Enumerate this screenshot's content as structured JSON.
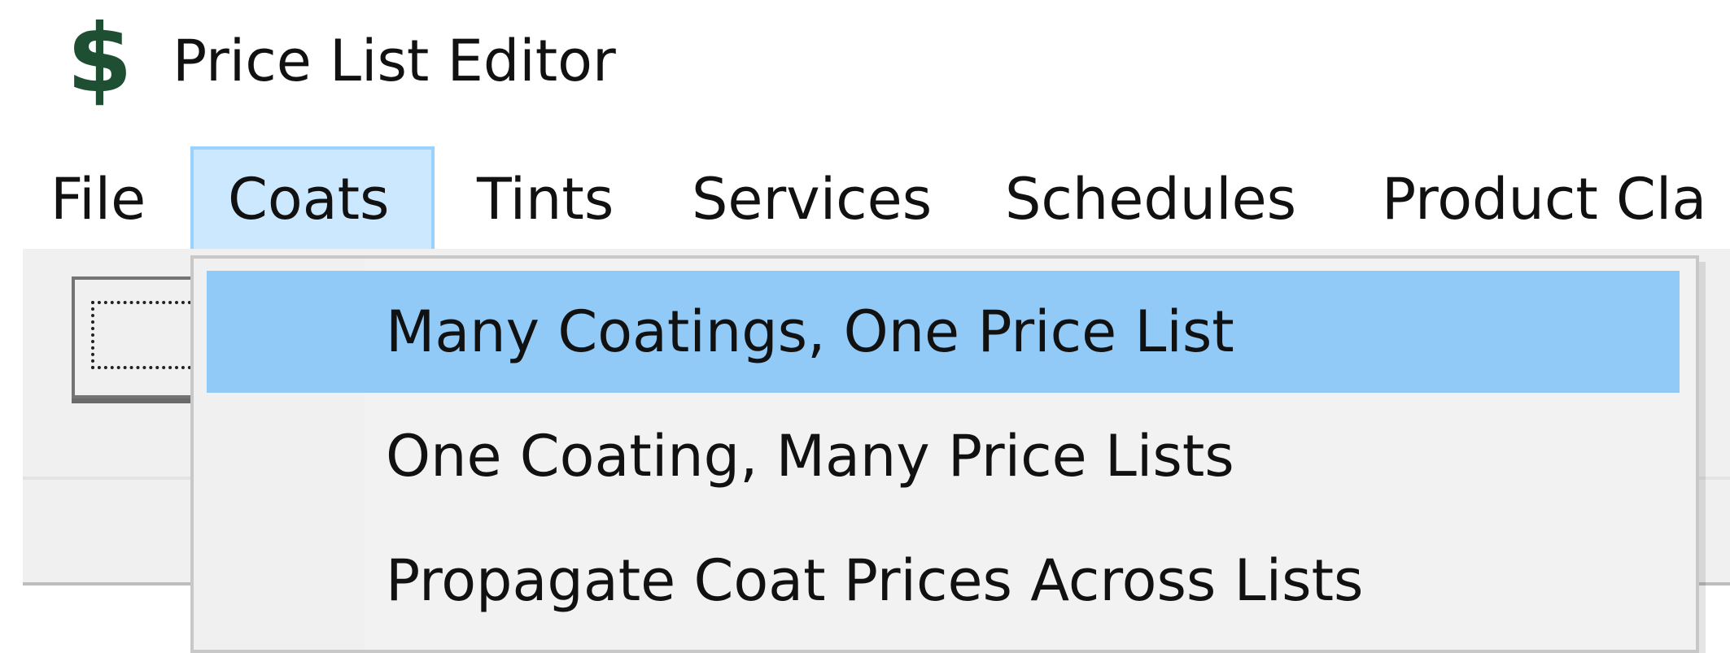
{
  "window": {
    "icon": "$",
    "title": "Price List Editor"
  },
  "menubar": {
    "items": [
      {
        "label": "File"
      },
      {
        "label": "Coats"
      },
      {
        "label": "Tints"
      },
      {
        "label": "Services"
      },
      {
        "label": "Schedules"
      },
      {
        "label": "Product Cla"
      }
    ]
  },
  "dropdown": {
    "items": [
      {
        "label": "Many Coatings, One Price List"
      },
      {
        "label": "One Coating, Many Price Lists"
      },
      {
        "label": "Propagate Coat Prices Across Lists"
      }
    ]
  },
  "icons": {
    "app": "dollar-icon"
  },
  "colors": {
    "accent": "#91c9f7",
    "active_menu": "#cce8ff",
    "active_menu_border": "#99d1ff",
    "menu_background": "#f2f2f2",
    "app_icon": "#1f4f33"
  }
}
